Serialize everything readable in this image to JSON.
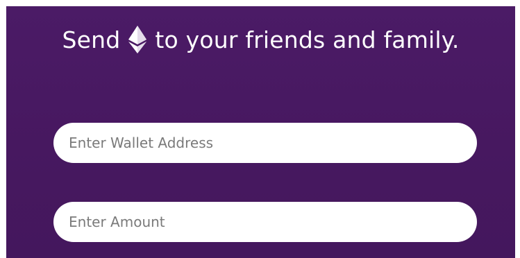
{
  "form": {
    "headline_before": "Send",
    "headline_icon": "ethereum-icon",
    "headline_after": "to your friends and family.",
    "wallet_address": {
      "placeholder": "Enter Wallet Address",
      "value": ""
    },
    "amount": {
      "placeholder": "Enter Amount",
      "value": ""
    }
  },
  "colors": {
    "panel_background": "#4a1a63",
    "text": "#ffffff",
    "input_background": "#ffffff",
    "placeholder": "#7a7a7a"
  }
}
